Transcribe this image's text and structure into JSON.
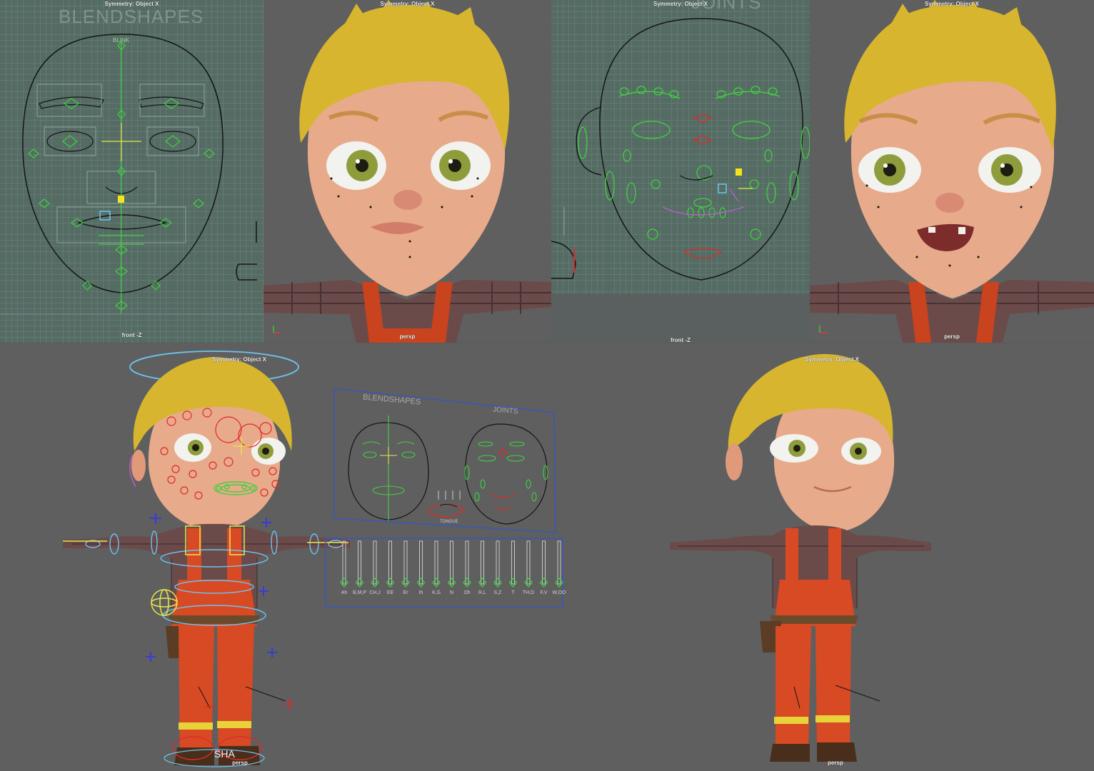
{
  "viewports": {
    "v1": {
      "symmetry": "Symmetry: Object X",
      "camera": "front -Z",
      "watermark": "BLENDSHAPES",
      "sub_label": "BLINK"
    },
    "v2": {
      "symmetry": "Symmetry: Object X",
      "camera": "persp"
    },
    "v3": {
      "symmetry": "Symmetry: Object X",
      "camera": "front -Z",
      "watermark": "JOINTS"
    },
    "v4": {
      "symmetry": "Symmetry: Object X",
      "camera": "persp"
    },
    "v5": {
      "symmetry": "Symmetry: Object X",
      "camera": "persp",
      "ground_label": "SHA",
      "face_panel": {
        "blendshapes_title": "BLENDSHAPES",
        "joints_title": "JOINTS",
        "tongue_label": "TONGUE"
      },
      "phoneme_sliders": [
        "Ah",
        "B,M,P",
        "CH,J",
        "EE",
        "Er",
        "Ih",
        "K,G",
        "N",
        "Oh",
        "R,L",
        "S,Z",
        "T",
        "TH,D",
        "F,V",
        "W,OO"
      ]
    },
    "v6": {
      "symmetry": "Symmetry: Object X",
      "camera": "persp"
    }
  },
  "colors": {
    "control_green": "#3fd13f",
    "curve_black": "#141414",
    "joint_red": "#e02a2a",
    "ring_blue": "#6cc3f0",
    "hair": "#d7b52e",
    "skin": "#e7aa8a",
    "overalls": "#d84a24"
  }
}
